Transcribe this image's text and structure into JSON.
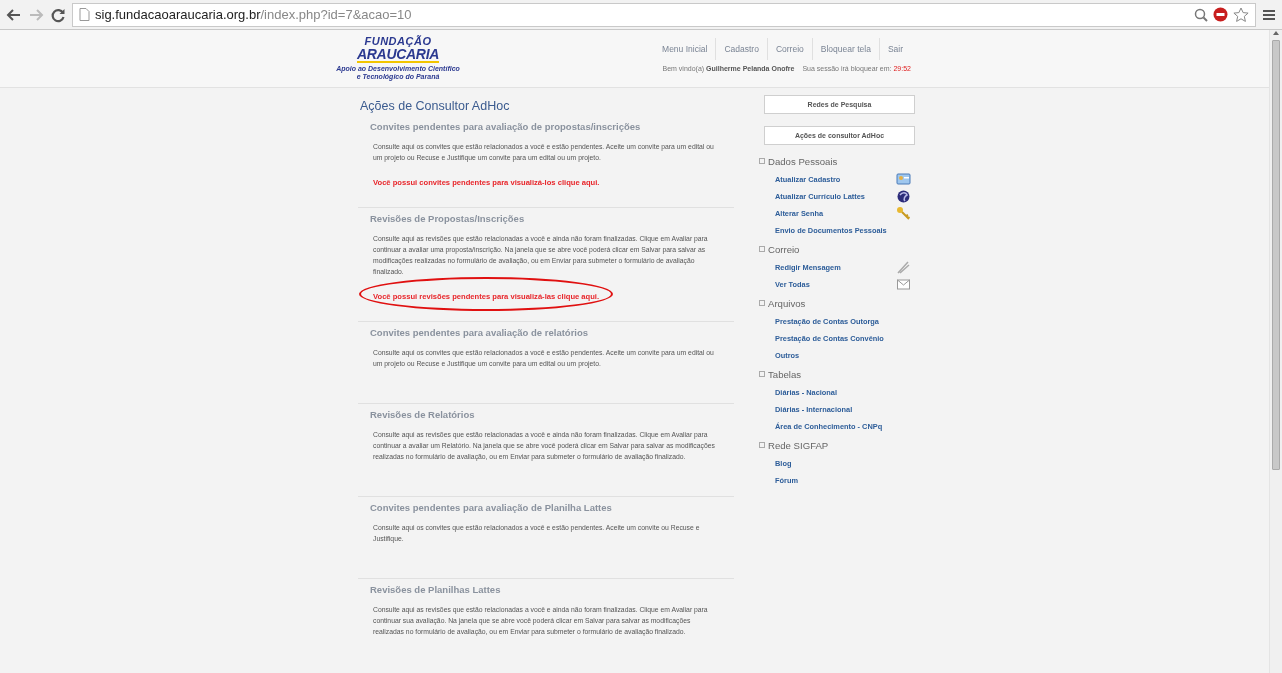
{
  "browser": {
    "url_host": "sig.fundacaoaraucaria.org.br",
    "url_path": "/index.php?id=7&acao=10"
  },
  "logo": {
    "line1": "FUNDAÇÃO",
    "line2": "ARAUCARIA",
    "tagline1": "Apoio ao Desenvolvimento Científico",
    "tagline2": "e Tecnológico do Paraná"
  },
  "nav": [
    "Menu Inicial",
    "Cadastro",
    "Correio",
    "Bloquear tela",
    "Sair"
  ],
  "welcome": {
    "prefix": "Bem vindo(a)",
    "user": "Guilherme Pelanda Onofre",
    "session_label": "Sua sessão irá bloquear em:",
    "timer": "29:52"
  },
  "page_title": "Ações de Consultor AdHoc",
  "sections": [
    {
      "title": "Convites pendentes para avaliação de propostas/inscrições",
      "text": "Consulte aqui os convites que estão relacionados a você e estão pendentes. Aceite um convite para um edital ou um projeto ou Recuse e Justifique um convite para um edital ou um projeto.",
      "link": "Você possui convites pendentes para visualizá-los clique aqui.",
      "circled": false
    },
    {
      "title": "Revisões de Propostas/Inscrições",
      "text": "Consulte aqui as revisões que estão relacionadas a você e ainda não foram finalizadas. Clique em Avaliar para continuar a avaliar uma proposta/inscrição. Na janela que se abre você poderá clicar em Salvar para salvar as modificações realizadas no formulário de avaliação, ou em Enviar para submeter o formulário de avaliação finalizado.",
      "link": "Você possui revisões pendentes para visualizá-las clique aqui.",
      "circled": true
    },
    {
      "title": "Convites pendentes para avaliação de relatórios",
      "text": "Consulte aqui os convites que estão relacionados a você e estão pendentes. Aceite um convite para um edital ou um projeto ou Recuse e Justifique um convite para um edital ou um projeto."
    },
    {
      "title": "Revisões de Relatórios",
      "text": "Consulte aqui as revisões que estão relacionadas a você e ainda não foram finalizadas. Clique em Avaliar para continuar a avaliar um Relatório. Na janela que se abre você poderá clicar em Salvar para salvar as modificações realizadas no formulário de avaliação, ou em Enviar para submeter o formulário de avaliação finalizado."
    },
    {
      "title": "Convites pendentes para avaliação de Planilha Lattes",
      "text": "Consulte aqui os convites que estão relacionados a você e estão pendentes. Aceite um convite ou Recuse e Justifique."
    },
    {
      "title": "Revisões de Planilhas Lattes",
      "text": "Consulte aqui as revisões que estão relacionadas a você e ainda não foram finalizadas. Clique em Avaliar para continuar sua avaliação. Na janela que se abre você poderá clicar em Salvar para salvar as modificações realizadas no formulário de avaliação, ou em Enviar para submeter o formulário de avaliação finalizado."
    }
  ],
  "sidebar": {
    "buttons": [
      "Redes de Pesquisa",
      "Ações de consultor AdHoc"
    ],
    "groups": [
      {
        "title": "Dados Pessoais",
        "items": [
          "Atualizar Cadastro",
          "Atualizar Currículo Lattes",
          "Alterar Senha",
          "Envio de Documentos Pessoais"
        ]
      },
      {
        "title": "Correio",
        "items": [
          "Redigir Mensagem",
          "Ver Todas"
        ]
      },
      {
        "title": "Arquivos",
        "items": [
          "Prestação de Contas Outorga",
          "Prestação de Contas Convênio",
          "Outros"
        ]
      },
      {
        "title": "Tabelas",
        "items": [
          "Diárias - Nacional",
          "Diárias - Internacional",
          "Área de Conhecimento - CNPq"
        ]
      },
      {
        "title": "Rede SIGFAP",
        "items": [
          "Blog",
          "Fórum"
        ]
      }
    ]
  }
}
